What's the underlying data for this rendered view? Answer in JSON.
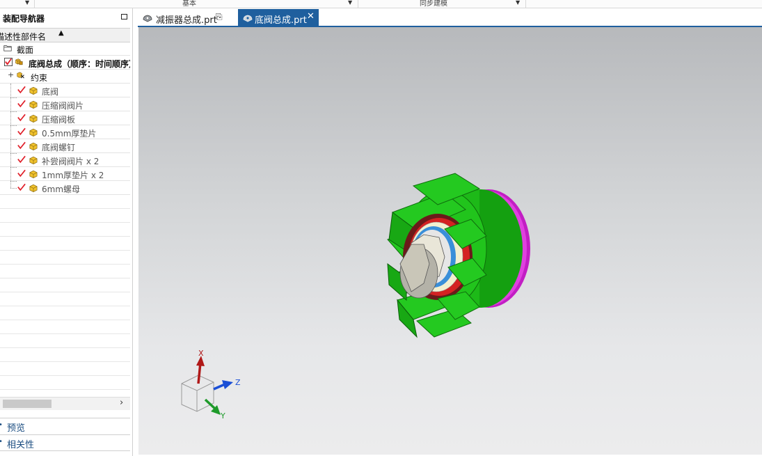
{
  "ribbon": {
    "group_basic": "基本",
    "group_sync": "同步建模"
  },
  "navigator": {
    "title": "装配导航器",
    "column_header": "描述性部件名",
    "rows": [
      {
        "label": "截面",
        "kind": "section-folder"
      },
      {
        "label": "底阀总成（顺序：时间顺序）",
        "kind": "root"
      },
      {
        "label": "约束",
        "kind": "constraints"
      },
      {
        "label": "底阀",
        "kind": "part"
      },
      {
        "label": "压缩阀阀片",
        "kind": "part"
      },
      {
        "label": "压缩阀板",
        "kind": "part"
      },
      {
        "label": "0.5mm厚垫片",
        "kind": "part"
      },
      {
        "label": "底阀螺钉",
        "kind": "part"
      },
      {
        "label": "补尝阀阀片 x 2",
        "kind": "part"
      },
      {
        "label": "1mm厚垫片 x 2",
        "kind": "part"
      },
      {
        "label": "6mm螺母",
        "kind": "part"
      }
    ],
    "section_preview": "预览",
    "section_dependency": "相关性"
  },
  "tabs": [
    {
      "label": "减振器总成.prt",
      "active": false
    },
    {
      "label": "底阀总成.prt",
      "active": true
    }
  ],
  "triad": {
    "x": "X",
    "y": "Y",
    "z": "Z"
  },
  "colors": {
    "accent": "#1f5f9e",
    "part_green": "#22c01e",
    "flange_magenta": "#d02ccf",
    "check_red": "#e0202a"
  }
}
